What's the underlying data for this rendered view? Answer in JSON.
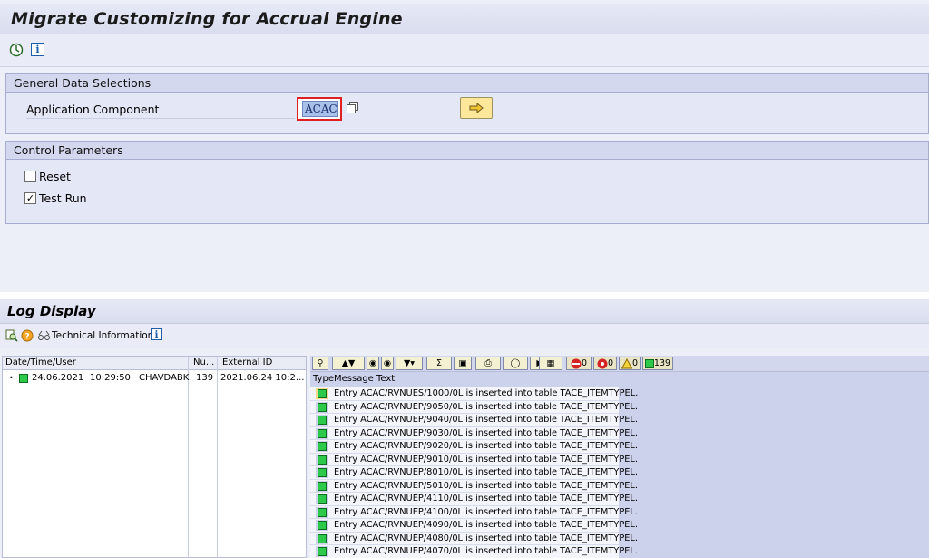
{
  "screen": {
    "title": "Migrate Customizing for Accrual Engine",
    "toolbar": {
      "execute_icon": "execute-clock-icon",
      "info_icon": "info-icon",
      "info_glyph": "i"
    }
  },
  "general_data": {
    "header": "General Data Selections",
    "app_component_label": "Application Component",
    "app_component_value": "ACAC"
  },
  "control_params": {
    "header": "Control Parameters",
    "reset_label": "Reset",
    "reset_checked": false,
    "testrun_label": "Test Run",
    "testrun_checked": true,
    "check_glyph": "✓"
  },
  "log": {
    "title": "Log Display",
    "toolbar": {
      "technical_info_label": "Technical Information",
      "info_glyph": "i"
    },
    "left_columns": [
      "Date/Time/User",
      "Nu...",
      "External ID"
    ],
    "entry": {
      "date": "24.06.2021",
      "time": "10:29:50",
      "user": "CHAVDABK",
      "number": "139",
      "external_id": "2021.06.24 10:2..."
    },
    "counters": {
      "stop": "0",
      "error": "0",
      "warning": "0",
      "success": "139"
    },
    "right_columns": [
      "Type",
      "Message Text"
    ],
    "messages": [
      "Entry ACAC/RVNUES/1000/0L is inserted into table TACE_ITEMTYPEL.",
      "Entry ACAC/RVNUEP/9050/0L is inserted into table TACE_ITEMTYPEL.",
      "Entry ACAC/RVNUEP/9040/0L is inserted into table TACE_ITEMTYPEL.",
      "Entry ACAC/RVNUEP/9030/0L is inserted into table TACE_ITEMTYPEL.",
      "Entry ACAC/RVNUEP/9020/0L is inserted into table TACE_ITEMTYPEL.",
      "Entry ACAC/RVNUEP/9010/0L is inserted into table TACE_ITEMTYPEL.",
      "Entry ACAC/RVNUEP/8010/0L is inserted into table TACE_ITEMTYPEL.",
      "Entry ACAC/RVNUEP/5010/0L is inserted into table TACE_ITEMTYPEL.",
      "Entry ACAC/RVNUEP/4110/0L is inserted into table TACE_ITEMTYPEL.",
      "Entry ACAC/RVNUEP/4100/0L is inserted into table TACE_ITEMTYPEL.",
      "Entry ACAC/RVNUEP/4090/0L is inserted into table TACE_ITEMTYPEL.",
      "Entry ACAC/RVNUEP/4080/0L is inserted into table TACE_ITEMTYPEL.",
      "Entry ACAC/RVNUEP/4070/0L is inserted into table TACE_ITEMTYPEL."
    ]
  },
  "colors": {
    "success": "#2cc94b",
    "required_border": "#e02020",
    "selected_row": "#f7d98a"
  }
}
